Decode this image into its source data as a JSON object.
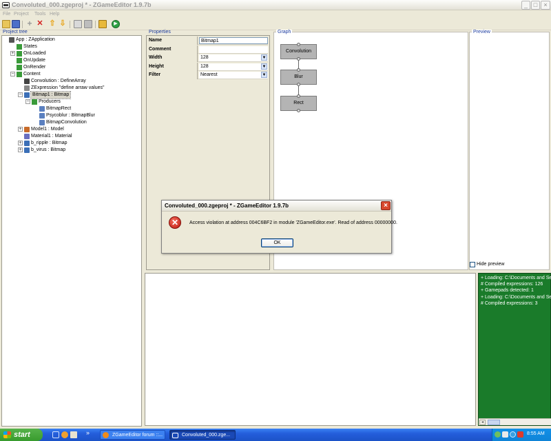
{
  "window": {
    "title": "Convoluted_000.zgeproj * - ZGameEditor 1.9.7b",
    "buttons": {
      "minimize": "_",
      "maximize": "□",
      "close": "×"
    }
  },
  "menu": [
    "File",
    "Project",
    "Tools",
    "Help"
  ],
  "toolbar": {
    "icons": [
      "open-folder-icon",
      "save-icon",
      "add-icon",
      "delete-icon",
      "move-up-icon",
      "move-down-icon",
      "copy-icon",
      "paste-icon",
      "lock-icon",
      "run-icon"
    ]
  },
  "project_tree": {
    "title": "Project tree",
    "items": [
      {
        "label": "App : ZApplication",
        "icon": "app-icon",
        "depth": 0,
        "expand": ""
      },
      {
        "label": "States",
        "icon": "tree-node-icon",
        "depth": 1,
        "expand": ""
      },
      {
        "label": "OnLoaded",
        "icon": "tree-node-icon",
        "depth": 1,
        "expand": "+"
      },
      {
        "label": "OnUpdate",
        "icon": "tree-node-icon",
        "depth": 1,
        "expand": ""
      },
      {
        "label": "OnRender",
        "icon": "tree-node-icon",
        "depth": 1,
        "expand": ""
      },
      {
        "label": "Content",
        "icon": "tree-node-icon",
        "depth": 1,
        "expand": "−"
      },
      {
        "label": "Convolution : DefineArray",
        "icon": "array-icon",
        "depth": 2,
        "expand": ""
      },
      {
        "label": "ZExpression \"define arraw values\"",
        "icon": "expression-icon",
        "depth": 2,
        "expand": ""
      },
      {
        "label": "Bitmap1 : Bitmap",
        "icon": "bitmap-icon",
        "depth": 2,
        "expand": "−",
        "selected": true
      },
      {
        "label": "Producers",
        "icon": "tree-node-icon",
        "depth": 3,
        "expand": "−"
      },
      {
        "label": "BitmapRect",
        "icon": "producer-icon",
        "depth": 4,
        "expand": ""
      },
      {
        "label": "Psycoblur : BitmapBlur",
        "icon": "producer-icon",
        "depth": 4,
        "expand": ""
      },
      {
        "label": "BitmapConvolution",
        "icon": "producer-icon",
        "depth": 4,
        "expand": ""
      },
      {
        "label": "Model1 : Model",
        "icon": "model-icon",
        "depth": 2,
        "expand": "+"
      },
      {
        "label": "Material1 : Material",
        "icon": "material-icon",
        "depth": 2,
        "expand": ""
      },
      {
        "label": "b_ripple : Bitmap",
        "icon": "bitmap-icon",
        "depth": 2,
        "expand": "+"
      },
      {
        "label": "b_virus : Bitmap",
        "icon": "bitmap-icon",
        "depth": 2,
        "expand": "+"
      }
    ]
  },
  "properties": {
    "title": "Properties",
    "rows": [
      {
        "name": "Name",
        "value": "Bitmap1",
        "dropdown": false,
        "boxed": true
      },
      {
        "name": "Comment",
        "value": "",
        "dropdown": false,
        "boxed": false
      },
      {
        "name": "Width",
        "value": "128",
        "dropdown": true,
        "boxed": false
      },
      {
        "name": "Height",
        "value": "128",
        "dropdown": true,
        "boxed": false
      },
      {
        "name": "Filter",
        "value": "Nearest",
        "dropdown": true,
        "boxed": false
      }
    ]
  },
  "graph": {
    "title": "Graph",
    "nodes": [
      "Convolution",
      "Blur",
      "Rect"
    ]
  },
  "preview": {
    "title": "Preview",
    "hide_label": "Hide preview",
    "hide_checked": false
  },
  "log": {
    "background": "#1a7b2a",
    "lines": [
      "+ Loading: C:\\Documents and Sett",
      "# Compiled expressions: 126",
      "+ Gamepads detected: 1",
      "+ Loading: C:\\Documents and Sett",
      "# Compiled expressions: 3"
    ]
  },
  "dialog": {
    "title": "Convoluted_000.zgeproj * - ZGameEditor 1.9.7b",
    "message": "Access violation at address 004C6BF2 in module 'ZGameEditor.exe'. Read of address 00000000.",
    "ok_label": "OK",
    "close": "×",
    "icon": "error-icon"
  },
  "taskbar": {
    "start_label": "start",
    "quicklaunch_overflow": "»",
    "tasks": [
      {
        "label": "ZGameEditor forum ::...",
        "active": false
      },
      {
        "label": "Convoluted_000.zge...",
        "active": true
      }
    ],
    "clock": "8:55 AM"
  }
}
